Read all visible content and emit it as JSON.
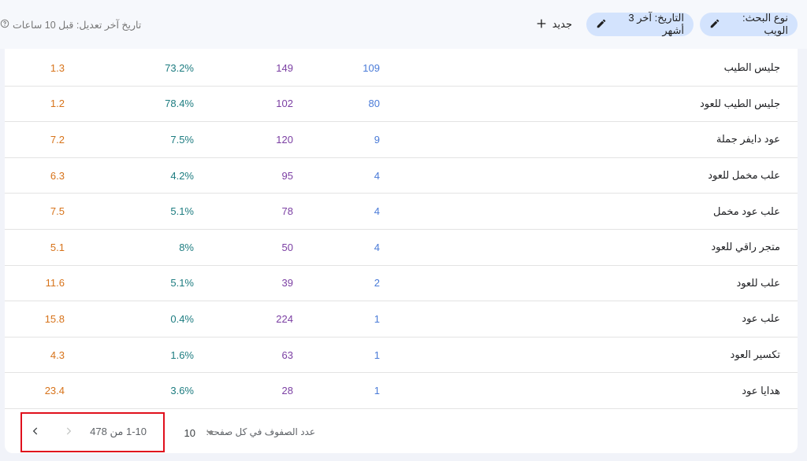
{
  "filters": {
    "search_type": "نوع البحث: الويب",
    "date": "التاريخ: آخر 3 أشهر",
    "new_label": "جديد",
    "last_edit": "تاريخ آخر تعديل: قبل 10 ساعات"
  },
  "table": {
    "rows": [
      {
        "query": "جليس الطيب",
        "clicks": "109",
        "impressions": "149",
        "ctr": "73.2%",
        "position": "1.3"
      },
      {
        "query": "جليس الطيب للعود",
        "clicks": "80",
        "impressions": "102",
        "ctr": "78.4%",
        "position": "1.2"
      },
      {
        "query": "عود دايفر جملة",
        "clicks": "9",
        "impressions": "120",
        "ctr": "7.5%",
        "position": "7.2"
      },
      {
        "query": "علب مخمل للعود",
        "clicks": "4",
        "impressions": "95",
        "ctr": "4.2%",
        "position": "6.3"
      },
      {
        "query": "علب عود مخمل",
        "clicks": "4",
        "impressions": "78",
        "ctr": "5.1%",
        "position": "7.5"
      },
      {
        "query": "متجر راقي للعود",
        "clicks": "4",
        "impressions": "50",
        "ctr": "8%",
        "position": "5.1"
      },
      {
        "query": "علب للعود",
        "clicks": "2",
        "impressions": "39",
        "ctr": "5.1%",
        "position": "11.6"
      },
      {
        "query": "علب عود",
        "clicks": "1",
        "impressions": "224",
        "ctr": "0.4%",
        "position": "15.8"
      },
      {
        "query": "تكسير العود",
        "clicks": "1",
        "impressions": "63",
        "ctr": "1.6%",
        "position": "4.3"
      },
      {
        "query": "هدايا عود",
        "clicks": "1",
        "impressions": "28",
        "ctr": "3.6%",
        "position": "23.4"
      }
    ]
  },
  "pagination": {
    "rows_per_page_label": "عدد الصفوف في كل صفحة:",
    "rows_per_page": "10",
    "range": "1-10 من 478"
  },
  "colors": {
    "clicks": "#4a7bd8",
    "impressions": "#7b3fa3",
    "ctr": "#1d7c80",
    "position": "#d7731a",
    "chip_bg": "#d3e3fd",
    "highlight": "#e0101d"
  },
  "icons": {
    "edit": "pencil-icon",
    "add": "plus-icon",
    "help": "help-circle-icon",
    "next": "chevron-right-icon",
    "prev": "chevron-left-icon"
  }
}
